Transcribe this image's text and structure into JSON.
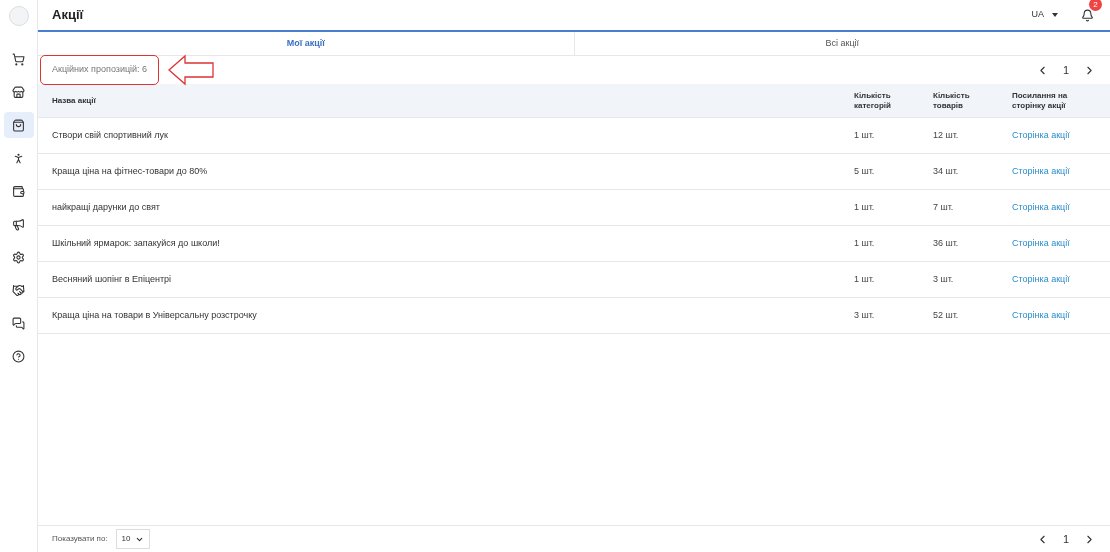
{
  "header": {
    "title": "Акції",
    "language": "UA",
    "notifications": "2"
  },
  "sidebar": {
    "items": [
      {
        "selected": false
      },
      {
        "selected": false
      },
      {
        "selected": true
      },
      {
        "selected": false
      },
      {
        "selected": false
      },
      {
        "selected": false
      },
      {
        "selected": false
      },
      {
        "selected": false
      },
      {
        "selected": false
      },
      {
        "selected": false
      }
    ]
  },
  "tabs": [
    {
      "label": "Мої акції",
      "selected": true
    },
    {
      "label": "Всі акції",
      "selected": false
    }
  ],
  "offer_count": "Акційних пропозицій: 6",
  "pagination_top": {
    "page": "1"
  },
  "table": {
    "columns": [
      "Назва акції",
      "Кількість категорій",
      "Кількість товарів",
      "Посилання на сторінку акції"
    ],
    "rows": [
      {
        "name": "Створи свій спортивний лук",
        "categories": "1 шт.",
        "products": "12 шт.",
        "link": "Сторінка акції"
      },
      {
        "name": "Краща ціна на фітнес-товари до 80%",
        "categories": "5 шт.",
        "products": "34 шт.",
        "link": "Сторінка акції"
      },
      {
        "name": "найкращі дарунки до свят",
        "categories": "1 шт.",
        "products": "7 шт.",
        "link": "Сторінка акції"
      },
      {
        "name": "Шкільний ярмарок: запакуйся до школи!",
        "categories": "1 шт.",
        "products": "36 шт.",
        "link": "Сторінка акції"
      },
      {
        "name": "Весняний шопінг в Епіцентрі",
        "categories": "1 шт.",
        "products": "3 шт.",
        "link": "Сторінка акції"
      },
      {
        "name": "Краща ціна на товари в Універсальну розстрочку",
        "categories": "3 шт.",
        "products": "52 шт.",
        "link": "Сторінка акції"
      }
    ]
  },
  "footer": {
    "page_size_label": "Показувати по:",
    "page_size": "10",
    "page": "1"
  }
}
